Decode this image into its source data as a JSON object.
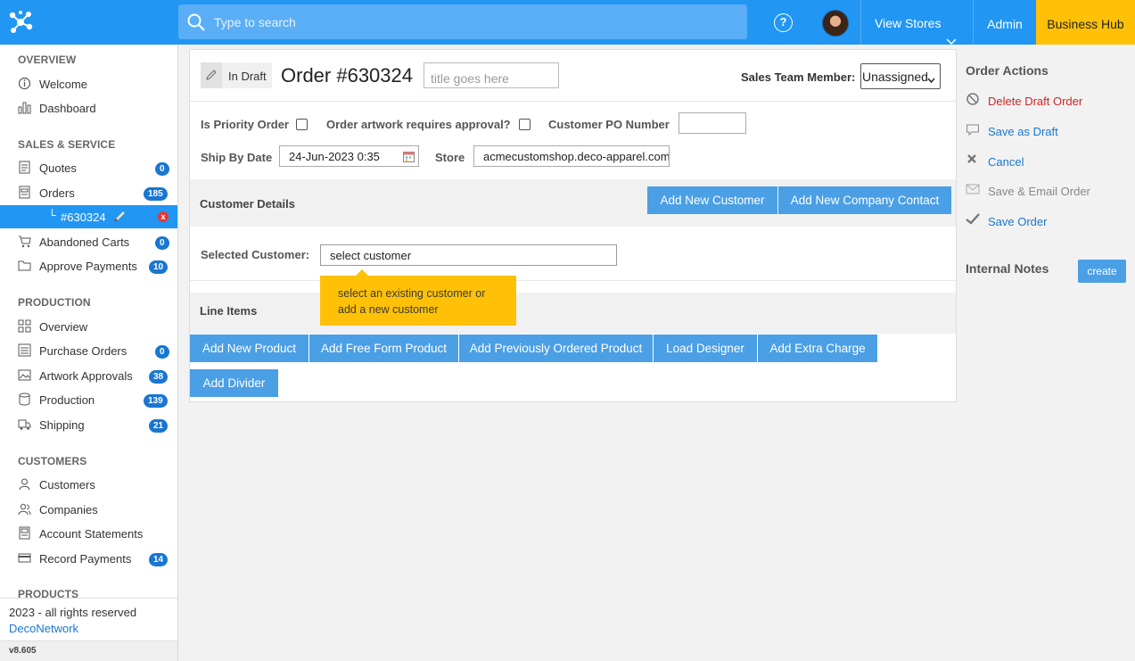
{
  "topbar": {
    "search_placeholder": "Type to search",
    "help_label": "?",
    "view_stores": "View Stores",
    "admin": "Admin",
    "business_hub": "Business Hub"
  },
  "sidebar": {
    "sections": {
      "overview": "OVERVIEW",
      "sales": "SALES & SERVICE",
      "production": "PRODUCTION",
      "customers": "CUSTOMERS",
      "products": "PRODUCTS"
    },
    "items": {
      "welcome": {
        "label": "Welcome",
        "icon": "info-icon"
      },
      "dashboard": {
        "label": "Dashboard",
        "icon": "bar-chart-icon"
      },
      "quotes": {
        "label": "Quotes",
        "badge": "0",
        "icon": "document-icon"
      },
      "orders": {
        "label": "Orders",
        "badge": "185",
        "icon": "document-list-icon"
      },
      "current_order": {
        "label": "#630324",
        "branch": "└",
        "close": "x"
      },
      "abandoned_carts": {
        "label": "Abandoned Carts",
        "badge": "0",
        "icon": "cart-icon"
      },
      "approve_payments": {
        "label": "Approve Payments",
        "badge": "10",
        "icon": "folder-icon"
      },
      "prod_overview": {
        "label": "Overview",
        "icon": "grid-icon"
      },
      "purchase_orders": {
        "label": "Purchase Orders",
        "badge": "0",
        "icon": "list-icon"
      },
      "artwork_approvals": {
        "label": "Artwork Approvals",
        "badge": "38",
        "icon": "image-icon"
      },
      "production": {
        "label": "Production",
        "badge": "139",
        "icon": "cylinder-icon"
      },
      "shipping": {
        "label": "Shipping",
        "badge": "21",
        "icon": "truck-icon"
      },
      "customers": {
        "label": "Customers",
        "icon": "user-icon"
      },
      "companies": {
        "label": "Companies",
        "icon": "users-icon"
      },
      "account_statements": {
        "label": "Account Statements",
        "icon": "statement-icon"
      },
      "record_payments": {
        "label": "Record Payments",
        "badge": "14",
        "icon": "card-icon"
      }
    },
    "footer": {
      "copyright": "2023 - all rights reserved",
      "brand": "DecoNetwork",
      "version": "v8.605"
    }
  },
  "order": {
    "status": "In Draft",
    "title": "Order #630324",
    "title_placeholder": "title goes here",
    "sales_team_label": "Sales Team Member:",
    "sales_team_value": "Unassigned",
    "priority_label": "Is Priority Order",
    "artwork_label": "Order artwork requires approval?",
    "po_label": "Customer PO Number",
    "po_value": "",
    "ship_by_label": "Ship By Date",
    "ship_by_value": "24-Jun-2023 0:35",
    "store_label": "Store",
    "store_value": "acmecustomshop.deco-apparel.com"
  },
  "customer_details": {
    "title": "Customer Details",
    "add_customer": "Add New Customer",
    "add_contact": "Add New Company Contact",
    "selected_label": "Selected Customer:",
    "selected_value": "select customer",
    "tooltip": "select an existing customer or add a new customer"
  },
  "line_items": {
    "title": "Line Items",
    "buttons": [
      "Add New Product",
      "Add Free Form Product",
      "Add Previously Ordered Product",
      "Load Designer",
      "Add Extra Charge",
      "Add Divider"
    ]
  },
  "actions": {
    "title": "Order Actions",
    "delete": "Delete Draft Order",
    "save_draft": "Save as Draft",
    "cancel": "Cancel",
    "save_email": "Save & Email Order",
    "save_order": "Save Order"
  },
  "notes": {
    "title": "Internal Notes",
    "create": "create"
  },
  "colors": {
    "primary": "#2196f3",
    "button": "#4a9fe5",
    "accent": "#ffc107",
    "badge": "#1976d2",
    "danger": "#c62828",
    "link": "#1976d2"
  }
}
